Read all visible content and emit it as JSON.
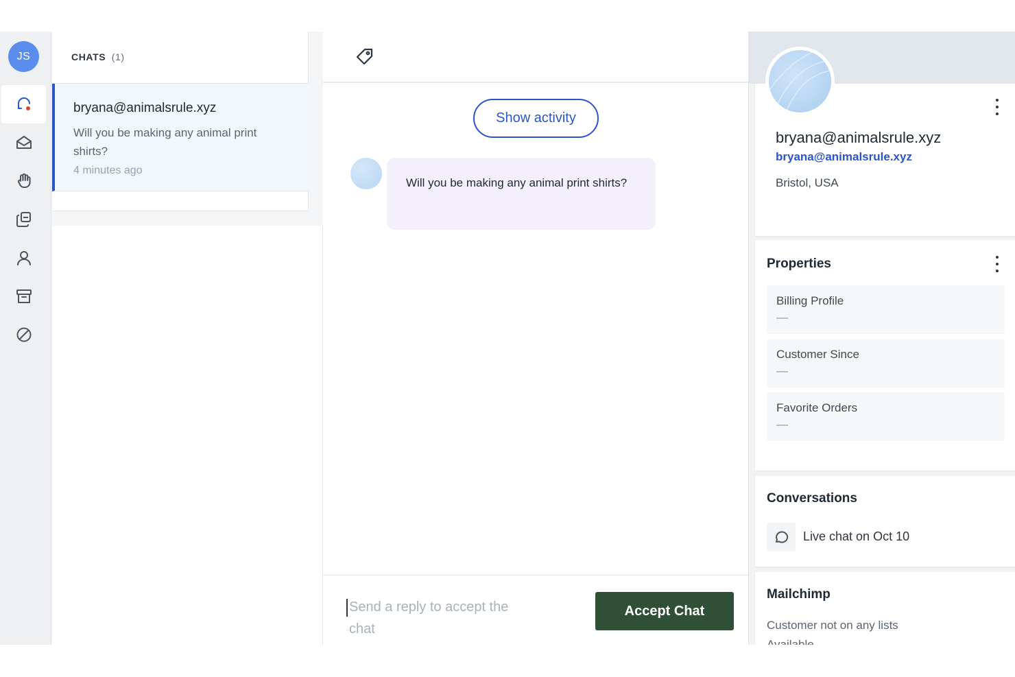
{
  "sidebar": {
    "user_initials": "JS",
    "items": [
      {
        "name": "chats",
        "icon": "chat-bubble-icon",
        "active": true
      },
      {
        "name": "inbox",
        "icon": "envelope-open-icon",
        "active": false
      },
      {
        "name": "held",
        "icon": "hand-icon",
        "active": false
      },
      {
        "name": "queues",
        "icon": "stacked-pages-icon",
        "active": false
      },
      {
        "name": "customers",
        "icon": "person-icon",
        "active": false
      },
      {
        "name": "archive",
        "icon": "archive-box-icon",
        "active": false
      },
      {
        "name": "blocked",
        "icon": "blocked-circle-icon",
        "active": false
      }
    ]
  },
  "chat_list": {
    "header": "CHATS",
    "count": "(1)",
    "items": [
      {
        "from": "bryana@animalsrule.xyz",
        "preview": "Will you be making any animal print shirts?",
        "time": "4 minutes ago"
      }
    ]
  },
  "conversation": {
    "show_activity_label": "Show activity",
    "messages": [
      {
        "text": "Will you be making any animal print shirts?"
      }
    ],
    "reply_placeholder": "Send a reply to accept the chat",
    "accept_label": "Accept Chat"
  },
  "profile": {
    "name": "bryana@animalsrule.xyz",
    "email": "bryana@animalsrule.xyz",
    "location": "Bristol, USA"
  },
  "properties": {
    "title": "Properties",
    "items": [
      {
        "label": "Billing Profile",
        "value": "—"
      },
      {
        "label": "Customer Since",
        "value": "—"
      },
      {
        "label": "Favorite Orders",
        "value": "—"
      }
    ]
  },
  "conversations": {
    "title": "Conversations",
    "items": [
      {
        "label": "Live chat on Oct 10"
      }
    ]
  },
  "mailchimp": {
    "title": "Mailchimp",
    "text": "Customer not on any lists",
    "text2": "Available..."
  },
  "colors": {
    "accent": "#2a55c9",
    "accept_button": "#2f4f36",
    "bubble": "#f4f0fb",
    "active_card": "#f2f7fd"
  }
}
